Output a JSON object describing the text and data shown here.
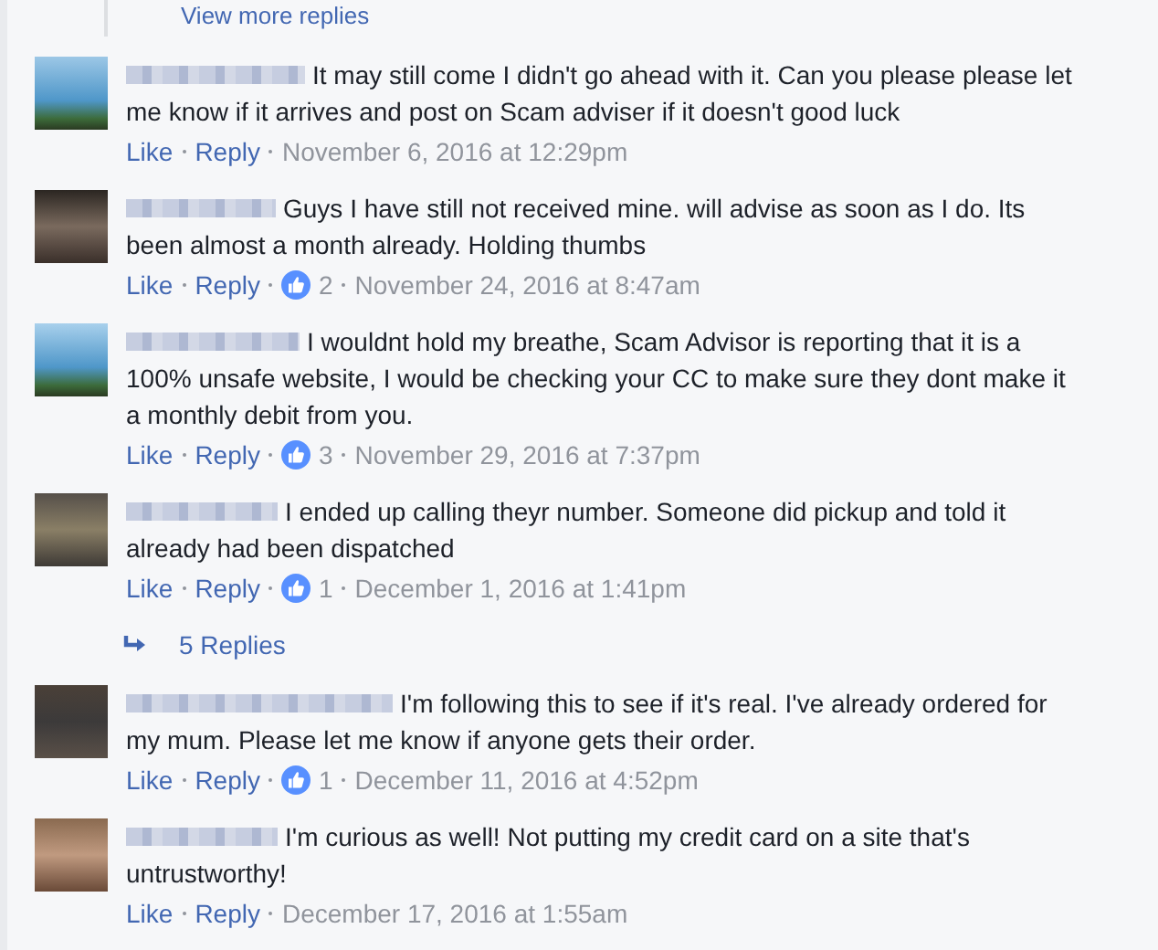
{
  "view_more": {
    "label": "View more replies"
  },
  "comments": [
    {
      "text": "It may still come I didn't go ahead with it. Can you please please let me know if it arrives and post on Scam adviser if it doesn't good luck",
      "like": "Like",
      "reply": "Reply",
      "date": "November 6, 2016 at 12:29pm"
    },
    {
      "text": "Guys I have still not received mine. will advise as soon as I do. Its been almost a month already. Holding thumbs",
      "like": "Like",
      "reply": "Reply",
      "reactions": "2",
      "date": "November 24, 2016 at 8:47am"
    },
    {
      "text": "I wouldnt hold my breathe, Scam Advisor is reporting that it is a 100% unsafe website, I would be checking your CC to make sure they dont make it a monthly debit from you.",
      "like": "Like",
      "reply": "Reply",
      "reactions": "3",
      "date": "November 29, 2016 at 7:37pm"
    },
    {
      "text": "I ended up calling theyr number. Someone did pickup and told it already had been dispatched",
      "like": "Like",
      "reply": "Reply",
      "reactions": "1",
      "date": "December 1, 2016 at 1:41pm",
      "replies_link": "5 Replies"
    },
    {
      "text": "I'm following this to see if it's real. I've already ordered for my mum. Please let me know if anyone gets their order.",
      "like": "Like",
      "reply": "Reply",
      "reactions": "1",
      "date": "December 11, 2016 at 4:52pm"
    },
    {
      "text": "I'm curious as well! Not putting my credit card on a site that's untrustworthy!",
      "like": "Like",
      "reply": "Reply",
      "date": "December 17, 2016 at 1:55am"
    }
  ]
}
